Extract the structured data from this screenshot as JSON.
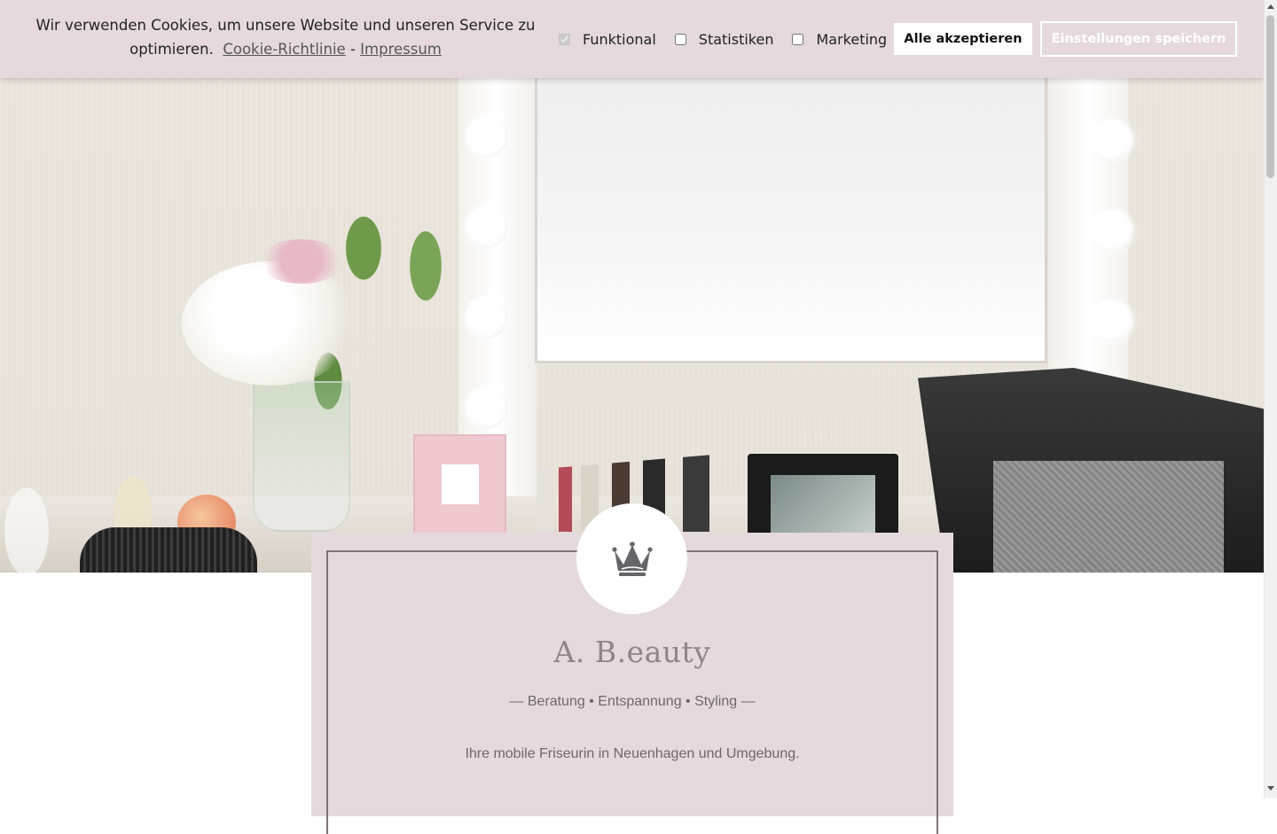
{
  "cookie_banner": {
    "text": "Wir verwenden Cookies, um unsere Website und unseren Service zu optimieren.",
    "policy_link": "Cookie-Richtlinie",
    "separator": "-",
    "imprint_link": "Impressum",
    "options": [
      {
        "label": "Funktional",
        "checked": true,
        "disabled": true
      },
      {
        "label": "Statistiken",
        "checked": false,
        "disabled": false
      },
      {
        "label": "Marketing",
        "checked": false,
        "disabled": false
      }
    ],
    "accept_all_label": "Alle akzeptieren",
    "save_settings_label": "Einstellungen speichern",
    "background_color": "#e5d9de"
  },
  "brand": {
    "logo_icon": "crown-icon",
    "name": "A. B.eauty",
    "tagline": "— Beratung • Entspannung • Styling —",
    "description": "Ihre mobile Friseurin in Neuenhagen und Umgebung.",
    "card_color": "#e5d9de",
    "text_color": "#8e8489"
  }
}
